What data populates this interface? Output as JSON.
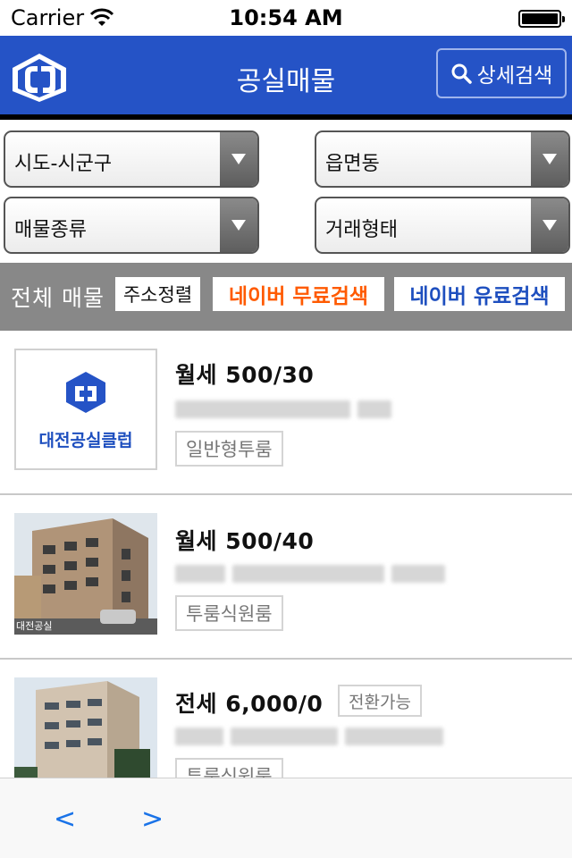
{
  "status": {
    "carrier": "Carrier",
    "time": "10:54 AM"
  },
  "header": {
    "title": "공실매물",
    "search_label": "상세검색"
  },
  "filters": {
    "region": "시도-시군구",
    "town": "읍면동",
    "property_type": "매물종류",
    "deal_type": "거래형태"
  },
  "sort_bar": {
    "all_label": "전체 매물",
    "address_sort": "주소정렬",
    "naver_free": "네이버 무료검색",
    "naver_paid": "네이버 유료검색"
  },
  "listings": [
    {
      "price": "월세 500/30",
      "tag": "일반형투룸",
      "logo_text": "대전공실클럽"
    },
    {
      "price": "월세 500/40",
      "tag": "투룸식원룸",
      "photo_caption": "대전공실"
    },
    {
      "price": "전세 6,000/0",
      "badge": "전환가능",
      "tag": "투룸식원룸"
    }
  ],
  "colors": {
    "nav": "#2553c6",
    "free": "#ff5a00",
    "paid": "#1e4fbf",
    "sort_bar": "#888888"
  },
  "bottom_nav": {
    "prev": "<",
    "next": ">"
  }
}
